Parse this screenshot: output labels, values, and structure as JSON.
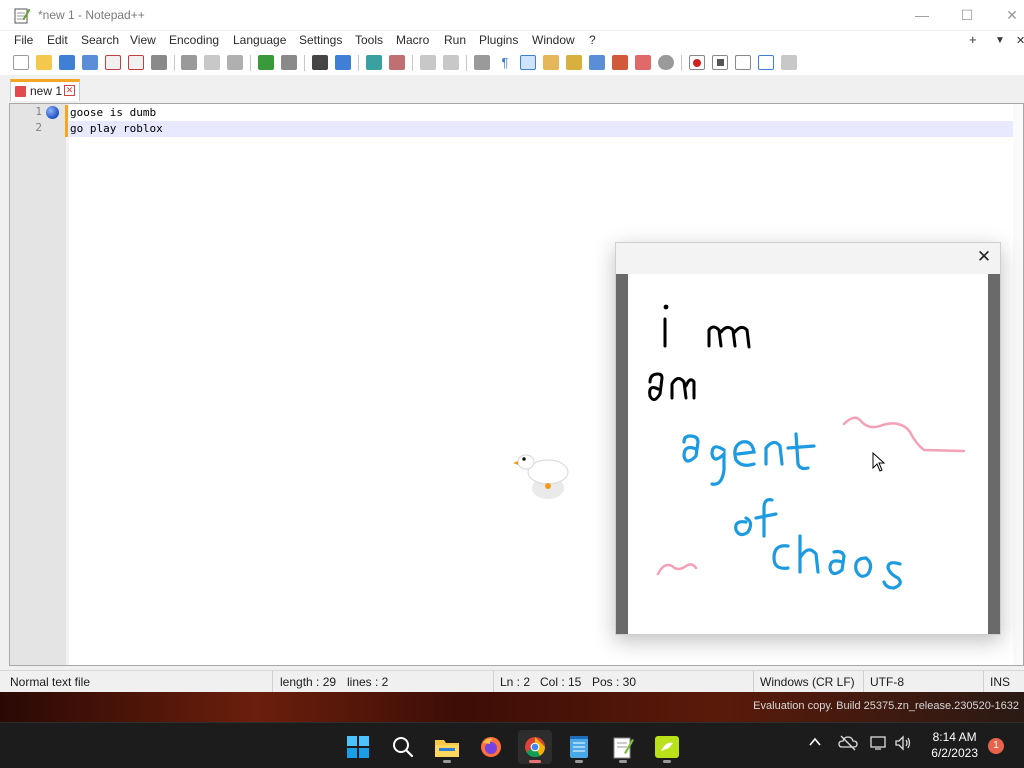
{
  "window": {
    "title": "*new 1 - Notepad++",
    "minimize": "—",
    "maximize": "☐",
    "close": "✕"
  },
  "menu": {
    "items": [
      "File",
      "Edit",
      "Search",
      "View",
      "Encoding",
      "Language",
      "Settings",
      "Tools",
      "Macro",
      "Run",
      "Plugins",
      "Window",
      "?"
    ],
    "right_plus": "+",
    "right_down": "▼",
    "right_close": "✕"
  },
  "tab": {
    "label": "new 1",
    "close": "✕"
  },
  "editor": {
    "lines": [
      {
        "number": "1",
        "text": "goose is dumb"
      },
      {
        "number": "2",
        "text": "go play roblox"
      }
    ]
  },
  "note": {
    "close": "✕",
    "handwriting": [
      "i m",
      "an",
      "agent",
      "of",
      "chaos"
    ]
  },
  "status": {
    "file_type": "Normal text file",
    "length": "length : 29",
    "lines": "lines : 2",
    "ln": "Ln : 2",
    "col": "Col : 15",
    "pos": "Pos : 30",
    "eol": "Windows (CR LF)",
    "encoding": "UTF-8",
    "mode": "INS"
  },
  "desktop": {
    "evaluation": "Evaluation copy. Build 25375.zn_release.230520-1632"
  },
  "taskbar": {
    "apps": [
      "start-icon",
      "search-icon",
      "file-explorer-icon",
      "firefox-icon",
      "chrome-icon",
      "notepad-icon",
      "notepad-plus-plus-icon",
      "desktop-goose-icon"
    ],
    "time": "8:14 AM",
    "date": "6/2/2023",
    "notifications": "1",
    "tray_chevron": "^"
  },
  "colors": {
    "accent_tab": "#f5a623",
    "pen_black": "#000000",
    "pen_blue": "#1e9be0",
    "pen_pink": "#f5a0b5"
  }
}
